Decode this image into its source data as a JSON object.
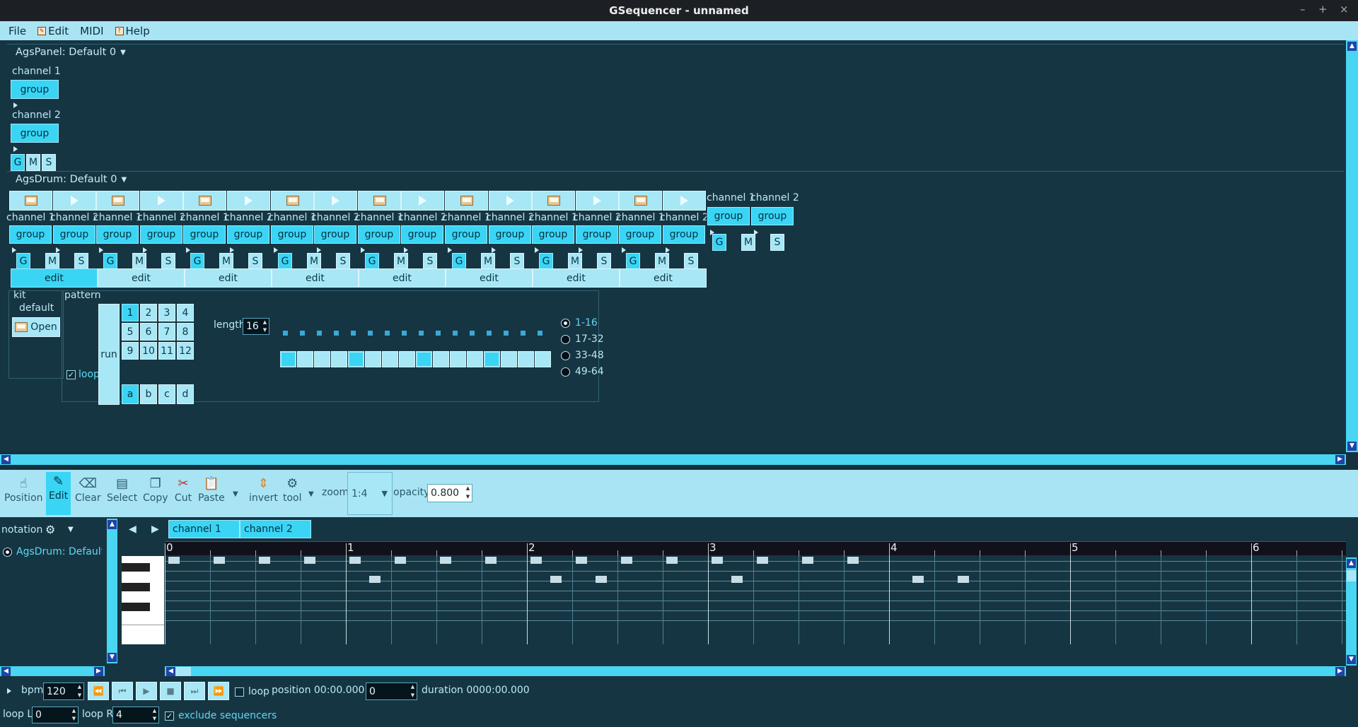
{
  "window": {
    "title": "GSequencer - unnamed"
  },
  "menubar": {
    "items": [
      "File",
      "Edit",
      "MIDI",
      "Help"
    ]
  },
  "panel": {
    "title": "AgsPanel: Default 0",
    "channels": [
      {
        "label": "channel 1",
        "button": "group"
      },
      {
        "label": "channel 2",
        "button": "group"
      }
    ],
    "gms": [
      "G",
      "M",
      "S"
    ]
  },
  "drum": {
    "title": "AgsDrum: Default 0",
    "input_channels": [
      "channel 1",
      "channel 2",
      "channel 1",
      "channel 2",
      "channel 1",
      "channel 2",
      "channel 1",
      "channel 2",
      "channel 1",
      "channel 2",
      "channel 1",
      "channel 2",
      "channel 1",
      "channel 2",
      "channel 1",
      "channel 2"
    ],
    "group_label": "group",
    "gms": [
      "G",
      "M",
      "S"
    ],
    "edit_label": "edit",
    "output_channels": [
      "channel 1",
      "channel 2"
    ],
    "kit_label": "kit",
    "kit_name": "default",
    "open_label": "Open",
    "pattern_label": "pattern",
    "run_label": "run",
    "loop_label": "loop",
    "index1": [
      "1",
      "2",
      "3",
      "4",
      "5",
      "6",
      "7",
      "8",
      "9",
      "10",
      "11",
      "12"
    ],
    "index0": [
      "a",
      "b",
      "c",
      "d"
    ],
    "length_label": "length",
    "length_value": "16",
    "offsets": [
      "1-16",
      "17-32",
      "33-48",
      "49-64"
    ],
    "pads_active": [
      0,
      4,
      8,
      12
    ]
  },
  "toolbar": {
    "position": "Position",
    "edit": "Edit",
    "clear": "Clear",
    "select": "Select",
    "copy": "Copy",
    "cut": "Cut",
    "paste": "Paste",
    "invert": "invert",
    "tool": "tool",
    "zoom_label": "zoom",
    "zoom_value": "1:4",
    "opacity_label": "opacity",
    "opacity_value": "0.800"
  },
  "editor": {
    "notation_label": "notation",
    "machine_item": "AgsDrum: Default 0",
    "tabs": [
      "channel 1",
      "channel 2"
    ],
    "ruler": [
      "0",
      "1",
      "2",
      "3",
      "4",
      "5",
      "6"
    ],
    "notes_row0": [
      0,
      1,
      2,
      3,
      4,
      5,
      6,
      7,
      8,
      9,
      10,
      11,
      12,
      13,
      14,
      15
    ],
    "notes_row1": [
      2,
      6,
      7,
      10,
      14,
      15
    ]
  },
  "transport": {
    "bpm_label": "bpm",
    "bpm_value": "120",
    "loop_label": "loop",
    "position_label": "position 00:00.000",
    "position_value": "0",
    "duration_label": "duration 0000:00.000",
    "loopl_label": "loop L",
    "loopl_value": "0",
    "loopr_label": "loop R",
    "loopr_value": "4",
    "exclude_label": "exclude sequencers"
  },
  "colors": {
    "accent": "#3ad5f5",
    "light": "#a7e7f6",
    "bg": "#163542"
  }
}
